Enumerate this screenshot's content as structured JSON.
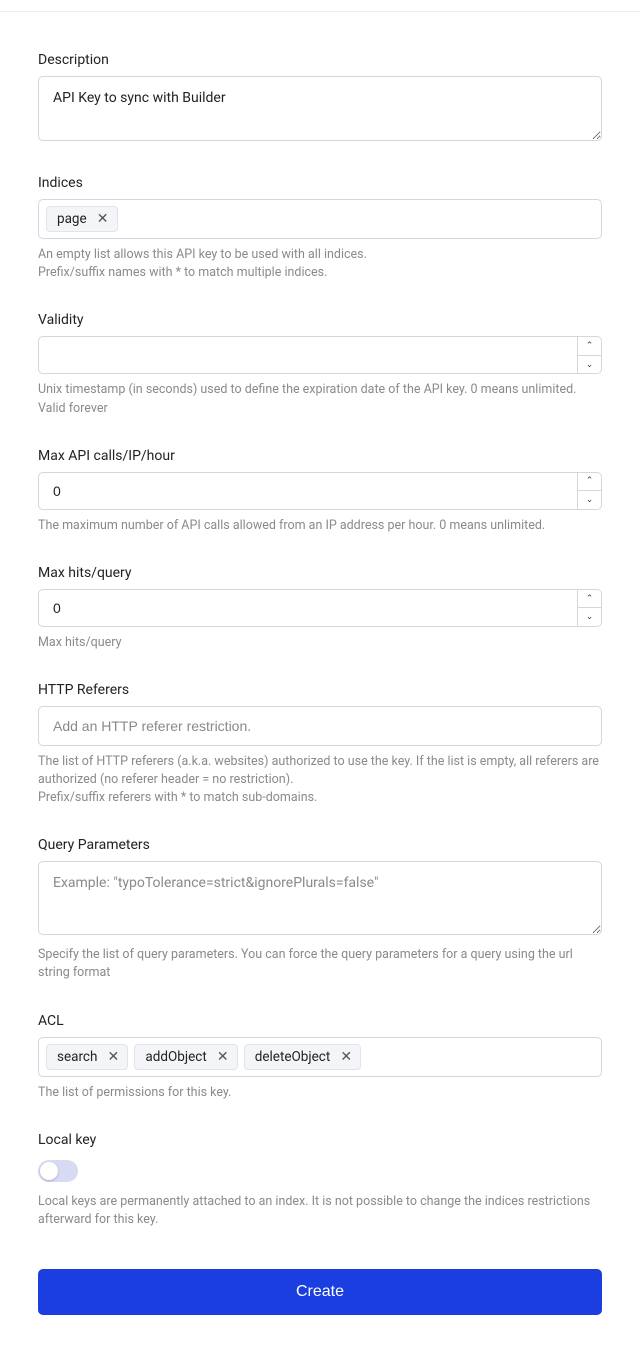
{
  "description": {
    "label": "Description",
    "value": "API Key to sync with Builder"
  },
  "indices": {
    "label": "Indices",
    "tags": [
      "page"
    ],
    "help1": "An empty list allows this API key to be used with all indices.",
    "help2": "Prefix/suffix names with * to match multiple indices."
  },
  "validity": {
    "label": "Validity",
    "value": "",
    "help1": "Unix timestamp (in seconds) used to define the expiration date of the API key. 0 means unlimited.",
    "help2": "Valid forever"
  },
  "maxCalls": {
    "label": "Max API calls/IP/hour",
    "value": "0",
    "help": "The maximum number of API calls allowed from an IP address per hour. 0 means unlimited."
  },
  "maxHits": {
    "label": "Max hits/query",
    "value": "0",
    "help": "Max hits/query"
  },
  "httpReferers": {
    "label": "HTTP Referers",
    "placeholder": "Add an HTTP referer restriction.",
    "help1": "The list of HTTP referers (a.k.a. websites) authorized to use the key. If the list is empty, all referers are authorized (no referer header = no restriction).",
    "help2": "Prefix/suffix referers with * to match sub-domains."
  },
  "queryParams": {
    "label": "Query Parameters",
    "placeholder": "Example: \"typoTolerance=strict&ignorePlurals=false\"",
    "help": "Specify the list of query parameters. You can force the query parameters for a query using the url string format"
  },
  "acl": {
    "label": "ACL",
    "tags": [
      "search",
      "addObject",
      "deleteObject"
    ],
    "help": "The list of permissions for this key."
  },
  "localKey": {
    "label": "Local key",
    "help": "Local keys are permanently attached to an index. It is not possible to change the indices restrictions afterward for this key."
  },
  "submit": {
    "label": "Create"
  }
}
